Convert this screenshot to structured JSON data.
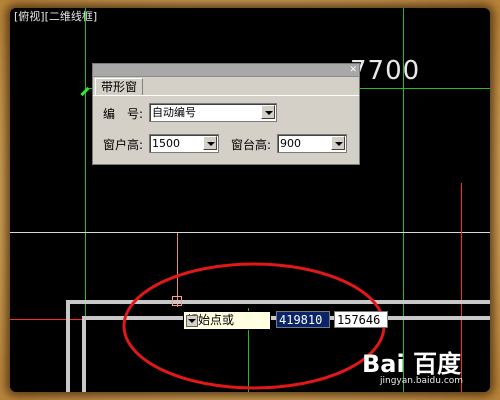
{
  "viewport": {
    "label": "[俯视][二维线框]"
  },
  "dimension_text": "7700",
  "dialog": {
    "close_glyph": "✕",
    "tab_label": "带形窗",
    "number_label": "编　号:",
    "number_value": "自动编号",
    "window_height_label": "窗户高:",
    "window_height_value": "1500",
    "sill_height_label": "窗台高:",
    "sill_height_value": "900"
  },
  "prompt": {
    "label": "起始点或"
  },
  "coords": {
    "x": "419810",
    "y": "157646"
  },
  "watermark": {
    "logo": "Bai 百度",
    "url": "jingyan.baidu.com"
  },
  "colors": {
    "canvas": "#000000",
    "highlight_ellipse": "#e01818",
    "axis_green": "#18c018",
    "guide_red": "#ff2020"
  }
}
